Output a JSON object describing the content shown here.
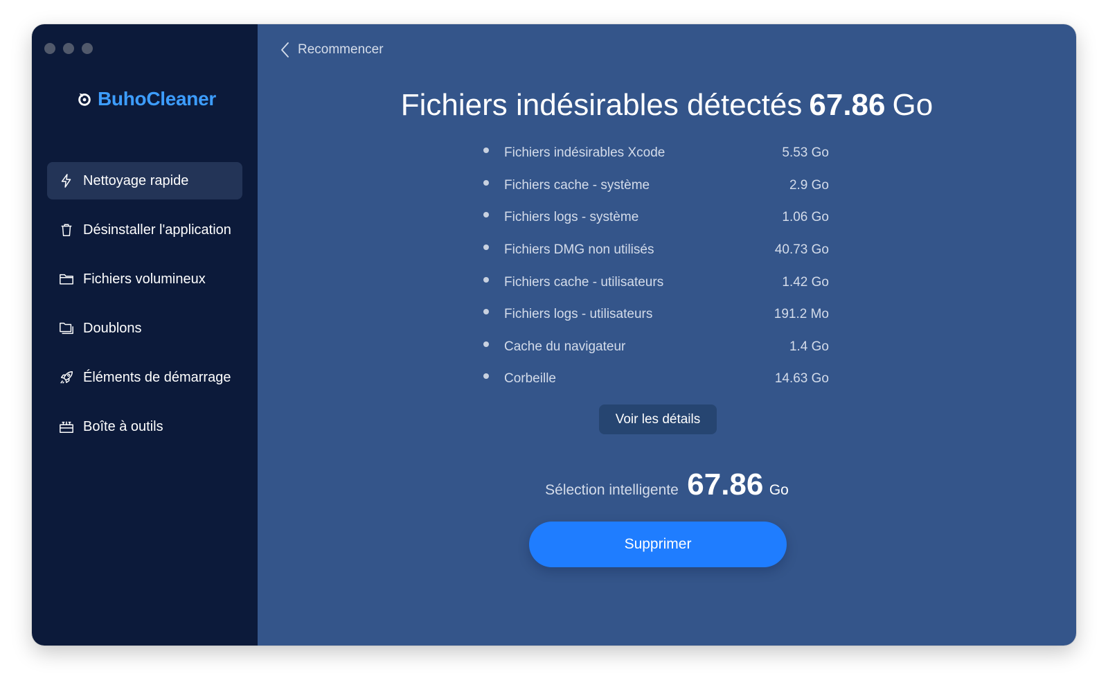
{
  "app": {
    "name": "BuhoCleaner",
    "accent_color": "#3d9dff"
  },
  "sidebar": {
    "items": [
      {
        "label": "Nettoyage rapide",
        "icon": "lightning-icon",
        "active": true
      },
      {
        "label": "Désinstaller l'application",
        "icon": "trash-icon",
        "active": false
      },
      {
        "label": "Fichiers volumineux",
        "icon": "folder-icon",
        "active": false
      },
      {
        "label": "Doublons",
        "icon": "duplicate-folder-icon",
        "active": false
      },
      {
        "label": "Éléments de démarrage",
        "icon": "rocket-icon",
        "active": false
      },
      {
        "label": "Boîte à outils",
        "icon": "toolbox-icon",
        "active": false
      }
    ]
  },
  "main": {
    "back_label": "Recommencer",
    "title_text": "Fichiers indésirables détectés",
    "title_amount": "67.86",
    "title_unit": "Go",
    "items": [
      {
        "label": "Fichiers indésirables Xcode",
        "size": "5.53 Go"
      },
      {
        "label": "Fichiers cache - système",
        "size": "2.9 Go"
      },
      {
        "label": "Fichiers logs - système",
        "size": "1.06 Go"
      },
      {
        "label": "Fichiers DMG non utilisés",
        "size": "40.73 Go"
      },
      {
        "label": "Fichiers cache - utilisateurs",
        "size": "1.42 Go"
      },
      {
        "label": "Fichiers logs - utilisateurs",
        "size": "191.2 Mo"
      },
      {
        "label": "Cache du navigateur",
        "size": "1.4 Go"
      },
      {
        "label": "Corbeille",
        "size": "14.63 Go"
      }
    ],
    "details_label": "Voir les détails",
    "smart_label": "Sélection intelligente",
    "smart_value": "67.86",
    "smart_unit": "Go",
    "delete_label": "Supprimer",
    "button_color": "#1f7dff"
  }
}
